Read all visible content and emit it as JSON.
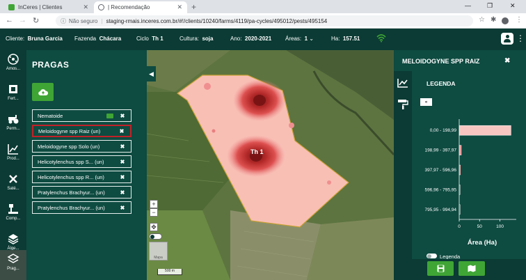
{
  "browser": {
    "tabs": [
      {
        "title": "InCeres | Clientes",
        "favicon_color": "#3fa535"
      },
      {
        "title": "| Recomendação",
        "favicon_color": "#5f6368"
      }
    ],
    "new_tab_icon": "plus-icon",
    "security_text": "Não seguro",
    "url": "staging-rmais.inceres.com.br/#!/clients/10240/farms/4119/pa-cycles/495012/pests/495154"
  },
  "header": {
    "client_label": "Cliente:",
    "client_value": "Bruna Garcia",
    "farm_label": "Fazenda",
    "farm_value": "Chácara",
    "cycle_label": "Ciclo",
    "cycle_value": "Th 1",
    "crop_label": "Cultura:",
    "crop_value": "soja",
    "year_label": "Ano:",
    "year_value": "2020-2021",
    "areas_label": "Áreas:",
    "areas_value": "1",
    "ha_label": "Ha:",
    "ha_value": "157.51",
    "wifi_color": "#3fa535"
  },
  "rail": [
    {
      "label": "Amos...",
      "icon": "sampling-icon"
    },
    {
      "label": "Fert...",
      "icon": "fertility-icon"
    },
    {
      "label": "Perm...",
      "icon": "tractor-icon"
    },
    {
      "label": "Prod...",
      "icon": "productivity-chart-icon"
    },
    {
      "label": "Saté...",
      "icon": "satellite-icon"
    },
    {
      "label": "Comp...",
      "icon": "compaction-icon"
    },
    {
      "label": "Álge...",
      "icon": "layers-algebra-icon"
    },
    {
      "label": "Prag...",
      "icon": "pests-layers-icon"
    }
  ],
  "pragas": {
    "title": "PRAGAS",
    "add_icon": "cloud-upload-icon",
    "items": [
      {
        "label": "Nematoide",
        "has_map_icon": true
      },
      {
        "label": "Meloidogyne spp Raiz (un)",
        "selected": true
      },
      {
        "label": "Meloidogyne spp Solo (un)"
      },
      {
        "label": "Helicotylenchus spp S... (un)"
      },
      {
        "label": "Helicotylenchus spp R... (un)"
      },
      {
        "label": "Pratylenchus Brachyur... (un)"
      },
      {
        "label": "Pratylenchus Brachyur... (un)"
      }
    ],
    "delete_symbol": "✖"
  },
  "map": {
    "field_label": "Th 1",
    "zoom_in": "+",
    "zoom_out": "−",
    "scale_label": "500 m",
    "basemap_label": "Mapa",
    "colors": {
      "field": "#f8bfb5",
      "hot": "#d94a4a",
      "core": "#8a1e1e",
      "border": "#c8a030"
    }
  },
  "legend_panel": {
    "title": "MELOIDOGYNE SPP RAIZ",
    "legend_title": "LEGENDA",
    "collapse": "«",
    "toggle_label": "Legenda"
  },
  "chart_data": {
    "type": "bar",
    "orientation": "horizontal",
    "categories": [
      "0,00 - 198,99",
      "198,99 - 397,97",
      "397,97 - 596,96",
      "596,96 - 795,95",
      "795,95 - 994,94"
    ],
    "values": [
      127,
      5,
      3,
      1.5,
      0.5
    ],
    "colors": [
      "#f8c6c0",
      "#f08f8f",
      "#dd5050",
      "#b52a2a",
      "#7a1414"
    ],
    "xlabel": "Área (Ha)",
    "xlim": [
      0,
      140
    ],
    "xticks": [
      0,
      50,
      100
    ]
  }
}
